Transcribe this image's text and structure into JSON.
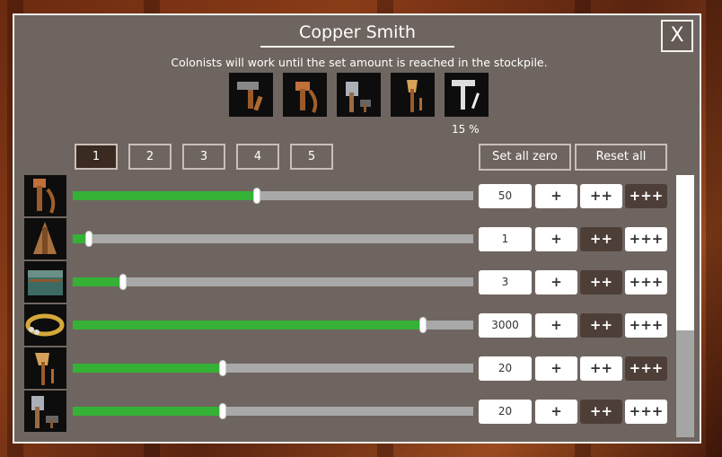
{
  "window": {
    "title": "Copper Smith",
    "close_label": "X",
    "subtitle": "Colonists will work until the set amount is reached in the stockpile."
  },
  "tools": {
    "icons": [
      "hammer-axe-icon",
      "copper-hammer-icon",
      "stone-axe-icon",
      "halberd-icon",
      "smith-hammer-icon"
    ],
    "percent": "15 %"
  },
  "tabs": [
    "1",
    "2",
    "3",
    "4",
    "5"
  ],
  "active_tab": "1",
  "actions": {
    "set_all_zero": "Set all zero",
    "reset_all": "Reset all"
  },
  "increment_labels": [
    "+",
    "++",
    "+++"
  ],
  "items": [
    {
      "icon": "copper-hammer-icon",
      "value": "50",
      "level": 0.46,
      "dark_button": 2
    },
    {
      "icon": "copper-cone-icon",
      "value": "1",
      "level": 0.04,
      "dark_button": 1
    },
    {
      "icon": "chest-icon",
      "value": "3",
      "level": 0.125,
      "dark_button": 1
    },
    {
      "icon": "gold-ring-icon",
      "value": "3000",
      "level": 0.875,
      "dark_button": 1
    },
    {
      "icon": "halberd-icon",
      "value": "20",
      "level": 0.375,
      "dark_button": 2
    },
    {
      "icon": "stone-axe-icon",
      "value": "20",
      "level": 0.375,
      "dark_button": 1
    }
  ],
  "colors": {
    "panel": "#6f6560",
    "fill": "#35b235",
    "track": "#a9a9a9",
    "dark_button": "#4d3f38"
  }
}
